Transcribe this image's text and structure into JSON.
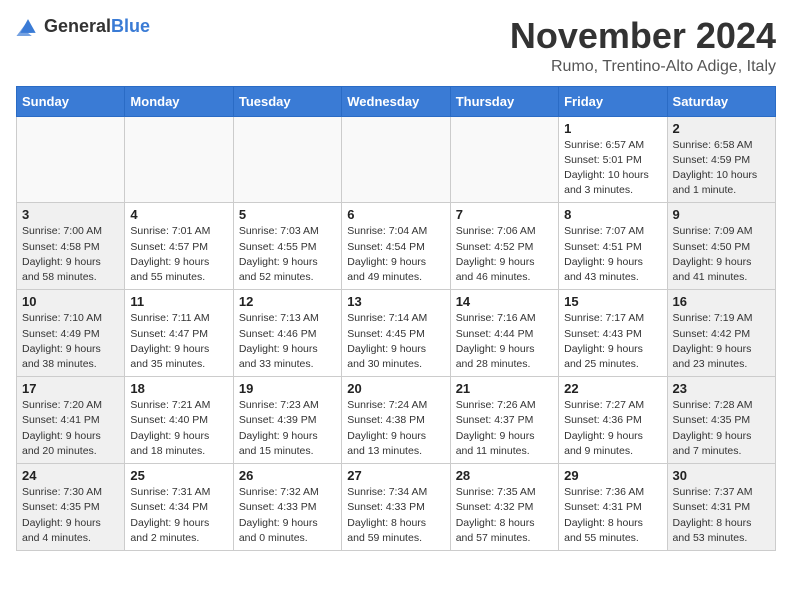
{
  "header": {
    "logo_general": "General",
    "logo_blue": "Blue",
    "title": "November 2024",
    "location": "Rumo, Trentino-Alto Adige, Italy"
  },
  "days_of_week": [
    "Sunday",
    "Monday",
    "Tuesday",
    "Wednesday",
    "Thursday",
    "Friday",
    "Saturday"
  ],
  "weeks": [
    [
      {
        "day": "",
        "info": ""
      },
      {
        "day": "",
        "info": ""
      },
      {
        "day": "",
        "info": ""
      },
      {
        "day": "",
        "info": ""
      },
      {
        "day": "",
        "info": ""
      },
      {
        "day": "1",
        "info": "Sunrise: 6:57 AM\nSunset: 5:01 PM\nDaylight: 10 hours and 3 minutes."
      },
      {
        "day": "2",
        "info": "Sunrise: 6:58 AM\nSunset: 4:59 PM\nDaylight: 10 hours and 1 minute."
      }
    ],
    [
      {
        "day": "3",
        "info": "Sunrise: 7:00 AM\nSunset: 4:58 PM\nDaylight: 9 hours and 58 minutes."
      },
      {
        "day": "4",
        "info": "Sunrise: 7:01 AM\nSunset: 4:57 PM\nDaylight: 9 hours and 55 minutes."
      },
      {
        "day": "5",
        "info": "Sunrise: 7:03 AM\nSunset: 4:55 PM\nDaylight: 9 hours and 52 minutes."
      },
      {
        "day": "6",
        "info": "Sunrise: 7:04 AM\nSunset: 4:54 PM\nDaylight: 9 hours and 49 minutes."
      },
      {
        "day": "7",
        "info": "Sunrise: 7:06 AM\nSunset: 4:52 PM\nDaylight: 9 hours and 46 minutes."
      },
      {
        "day": "8",
        "info": "Sunrise: 7:07 AM\nSunset: 4:51 PM\nDaylight: 9 hours and 43 minutes."
      },
      {
        "day": "9",
        "info": "Sunrise: 7:09 AM\nSunset: 4:50 PM\nDaylight: 9 hours and 41 minutes."
      }
    ],
    [
      {
        "day": "10",
        "info": "Sunrise: 7:10 AM\nSunset: 4:49 PM\nDaylight: 9 hours and 38 minutes."
      },
      {
        "day": "11",
        "info": "Sunrise: 7:11 AM\nSunset: 4:47 PM\nDaylight: 9 hours and 35 minutes."
      },
      {
        "day": "12",
        "info": "Sunrise: 7:13 AM\nSunset: 4:46 PM\nDaylight: 9 hours and 33 minutes."
      },
      {
        "day": "13",
        "info": "Sunrise: 7:14 AM\nSunset: 4:45 PM\nDaylight: 9 hours and 30 minutes."
      },
      {
        "day": "14",
        "info": "Sunrise: 7:16 AM\nSunset: 4:44 PM\nDaylight: 9 hours and 28 minutes."
      },
      {
        "day": "15",
        "info": "Sunrise: 7:17 AM\nSunset: 4:43 PM\nDaylight: 9 hours and 25 minutes."
      },
      {
        "day": "16",
        "info": "Sunrise: 7:19 AM\nSunset: 4:42 PM\nDaylight: 9 hours and 23 minutes."
      }
    ],
    [
      {
        "day": "17",
        "info": "Sunrise: 7:20 AM\nSunset: 4:41 PM\nDaylight: 9 hours and 20 minutes."
      },
      {
        "day": "18",
        "info": "Sunrise: 7:21 AM\nSunset: 4:40 PM\nDaylight: 9 hours and 18 minutes."
      },
      {
        "day": "19",
        "info": "Sunrise: 7:23 AM\nSunset: 4:39 PM\nDaylight: 9 hours and 15 minutes."
      },
      {
        "day": "20",
        "info": "Sunrise: 7:24 AM\nSunset: 4:38 PM\nDaylight: 9 hours and 13 minutes."
      },
      {
        "day": "21",
        "info": "Sunrise: 7:26 AM\nSunset: 4:37 PM\nDaylight: 9 hours and 11 minutes."
      },
      {
        "day": "22",
        "info": "Sunrise: 7:27 AM\nSunset: 4:36 PM\nDaylight: 9 hours and 9 minutes."
      },
      {
        "day": "23",
        "info": "Sunrise: 7:28 AM\nSunset: 4:35 PM\nDaylight: 9 hours and 7 minutes."
      }
    ],
    [
      {
        "day": "24",
        "info": "Sunrise: 7:30 AM\nSunset: 4:35 PM\nDaylight: 9 hours and 4 minutes."
      },
      {
        "day": "25",
        "info": "Sunrise: 7:31 AM\nSunset: 4:34 PM\nDaylight: 9 hours and 2 minutes."
      },
      {
        "day": "26",
        "info": "Sunrise: 7:32 AM\nSunset: 4:33 PM\nDaylight: 9 hours and 0 minutes."
      },
      {
        "day": "27",
        "info": "Sunrise: 7:34 AM\nSunset: 4:33 PM\nDaylight: 8 hours and 59 minutes."
      },
      {
        "day": "28",
        "info": "Sunrise: 7:35 AM\nSunset: 4:32 PM\nDaylight: 8 hours and 57 minutes."
      },
      {
        "day": "29",
        "info": "Sunrise: 7:36 AM\nSunset: 4:31 PM\nDaylight: 8 hours and 55 minutes."
      },
      {
        "day": "30",
        "info": "Sunrise: 7:37 AM\nSunset: 4:31 PM\nDaylight: 8 hours and 53 minutes."
      }
    ]
  ]
}
